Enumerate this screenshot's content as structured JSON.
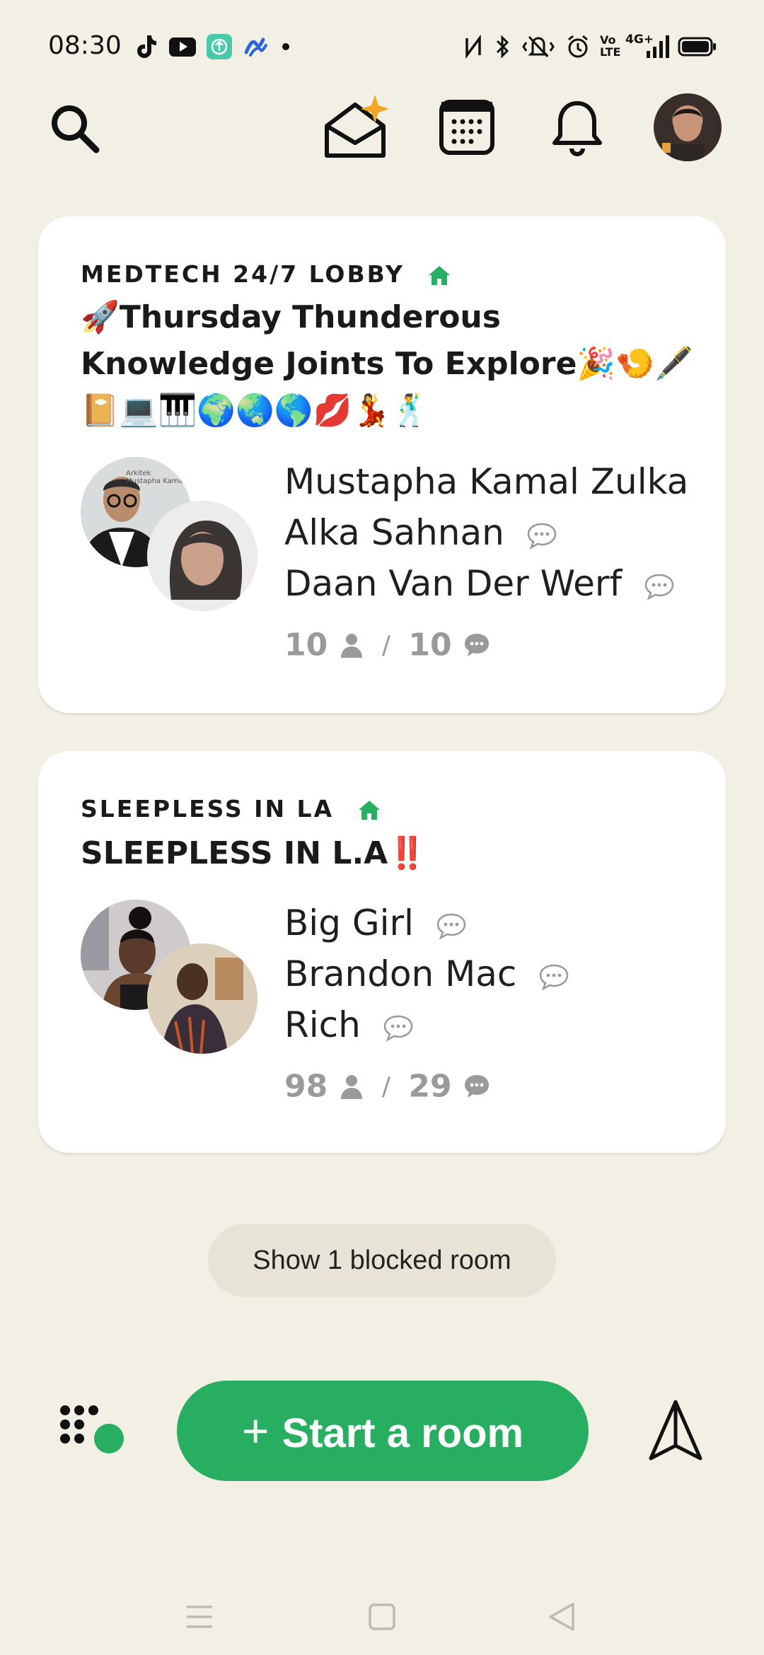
{
  "status_bar": {
    "time": "08:30",
    "network": "4G+",
    "icons": [
      "tiktok-icon",
      "youtube-icon",
      "upload-app-icon",
      "pen-app-icon",
      "dot-icon",
      "nfc-icon",
      "bluetooth-icon",
      "vibrate-icon",
      "alarm-icon",
      "volte-icon",
      "signal-icon",
      "battery-icon"
    ]
  },
  "top_nav": {
    "icons": [
      "search-icon",
      "invite-envelope-icon",
      "calendar-icon",
      "bell-icon",
      "profile-avatar"
    ]
  },
  "rooms": [
    {
      "club": "MEDTECH 24/7 LOBBY",
      "title": "🚀Thursday Thunderous Knowledge Joints To Explore🎉🍤🖋️📔💻🎹🌍🌏🌎💋💃🕺",
      "avatar_text": "Arkitek Mustapha Kamal",
      "speakers": [
        {
          "name": "Mustapha Kamal Zulka",
          "bubble": false
        },
        {
          "name": "Alka Sahnan",
          "bubble": true
        },
        {
          "name": "Daan Van Der Werf",
          "bubble": true
        }
      ],
      "listeners": "10",
      "separator": "/",
      "speaker_count": "10"
    },
    {
      "club": "SLEEPLESS IN LA",
      "title": "SLEEPLESS IN L.A‼️",
      "speakers": [
        {
          "name": "Big Girl",
          "bubble": true
        },
        {
          "name": "Brandon Mac",
          "bubble": true
        },
        {
          "name": "Rich",
          "bubble": true
        }
      ],
      "listeners": "98",
      "separator": "/",
      "speaker_count": "29"
    }
  ],
  "blocked_button": "Show 1 blocked room",
  "start_room": {
    "plus": "+",
    "label": "Start a room"
  },
  "bottom_icons": [
    "dots-grid-icon",
    "paper-plane-icon"
  ],
  "colors": {
    "background": "#f2efe4",
    "accent": "#27ae60",
    "card": "#ffffff"
  }
}
